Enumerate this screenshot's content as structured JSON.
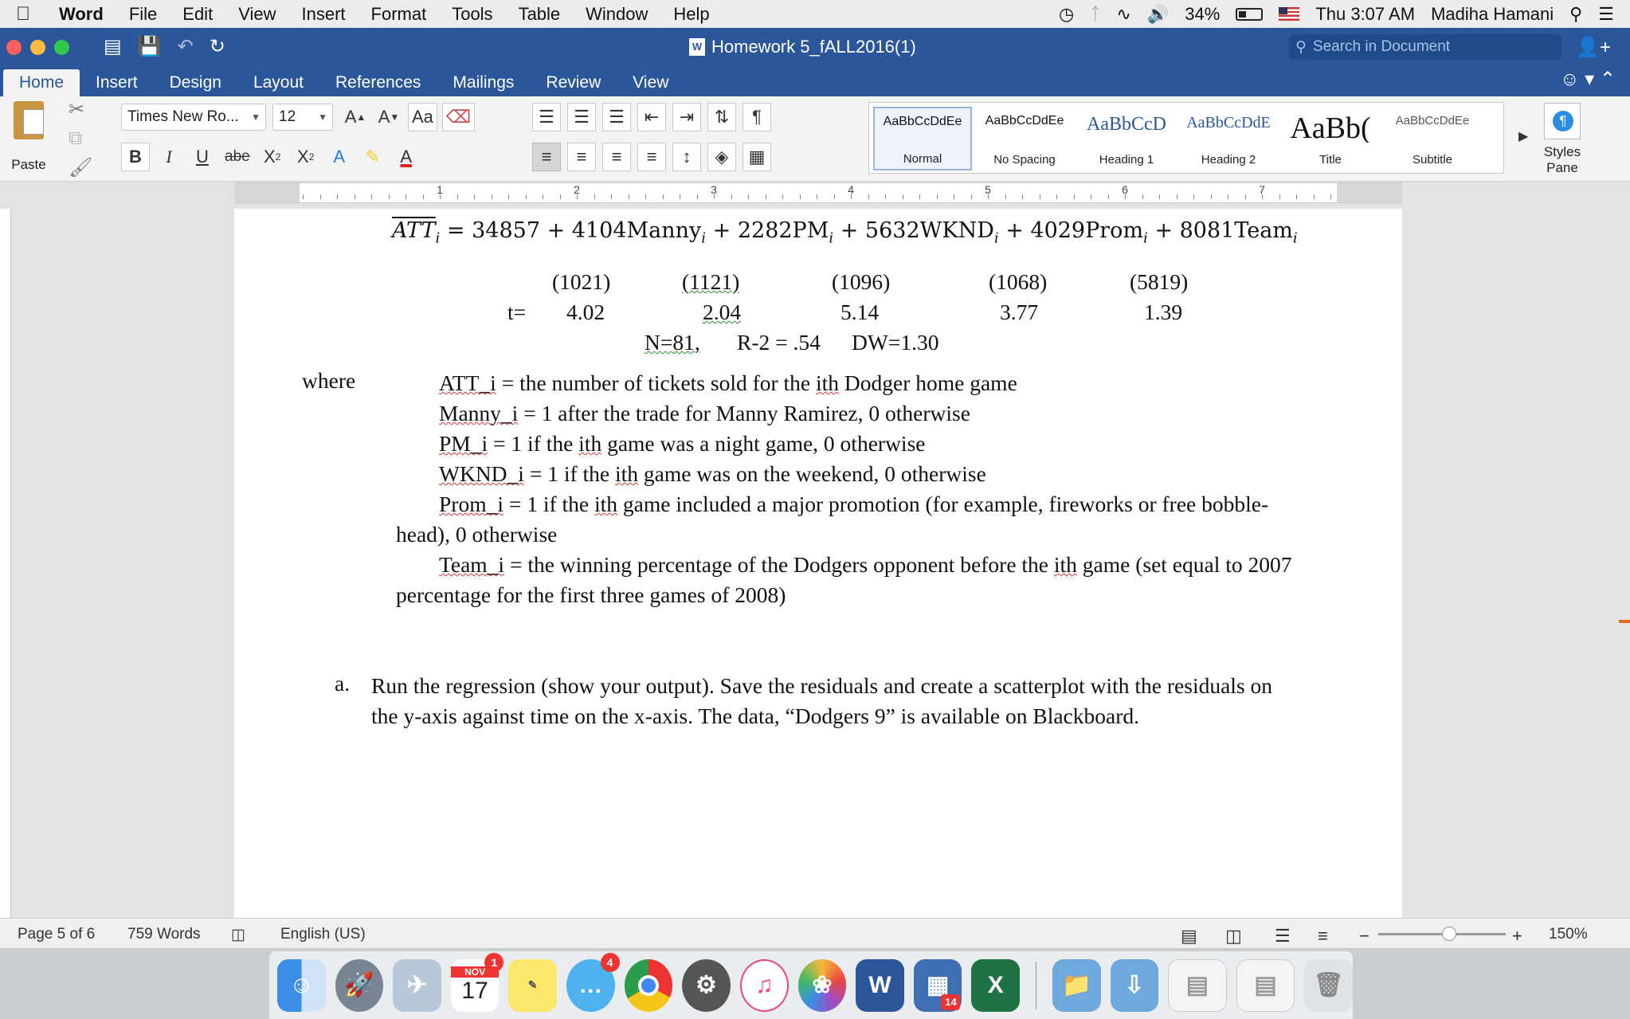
{
  "menubar": {
    "app": "Word",
    "items": [
      "File",
      "Edit",
      "View",
      "Insert",
      "Format",
      "Tools",
      "Table",
      "Window",
      "Help"
    ],
    "battery": "34%",
    "clock": "Thu 3:07 AM",
    "user": "Madiha Hamani"
  },
  "titlebar": {
    "document_title": "Homework 5_fALL2016(1)",
    "search_placeholder": "Search in Document"
  },
  "ribbon": {
    "tabs": [
      "Home",
      "Insert",
      "Design",
      "Layout",
      "References",
      "Mailings",
      "Review",
      "View"
    ],
    "active_tab": "Home",
    "paste_label": "Paste",
    "font_name": "Times New Ro...",
    "font_size": "12",
    "grow_font": "A",
    "shrink_font": "A",
    "change_case": "Aa",
    "bold": "B",
    "italic": "I",
    "underline": "U",
    "strikethrough": "abe",
    "subscript": "X",
    "superscript": "X",
    "text_effects": "A",
    "font_color": "A",
    "styles": [
      {
        "sample": "AaBbCcDdEe",
        "name": "Normal"
      },
      {
        "sample": "AaBbCcDdEe",
        "name": "No Spacing"
      },
      {
        "sample": "AaBbCcD",
        "name": "Heading 1"
      },
      {
        "sample": "AaBbCcDdE",
        "name": "Heading 2"
      },
      {
        "sample": "AaBb(",
        "name": "Title"
      },
      {
        "sample": "AaBbCcDdEe",
        "name": "Subtitle"
      }
    ],
    "styles_pane": "Styles Pane"
  },
  "ruler": {
    "numbers": [
      "1",
      "2",
      "3",
      "4",
      "5",
      "6",
      "7"
    ]
  },
  "document": {
    "equation": {
      "lhs": "ATT",
      "rhs": "= 34857 + 4104Manny",
      "t2": " + 2282PM",
      "t3": " + 5632WKND",
      "t4": " + 4029Prom",
      "t5": " + 8081Team",
      "sub": "i"
    },
    "std_errors": [
      "(1021)",
      "(1121)",
      "(1096)",
      "(1068)",
      "(5819)"
    ],
    "t_label": "t=",
    "t_values": [
      "4.02",
      "2.04",
      "5.14",
      "3.77",
      "1.39"
    ],
    "stats": {
      "n": "N=81,",
      "r2": "R-2 = .54",
      "dw": "DW=1.30"
    },
    "where": "where",
    "definitions": [
      {
        "var": "ATT_i",
        "text": " = the number of tickets sold for the ",
        "ith": "ith",
        "rest": " Dodger home game"
      },
      {
        "var": "Manny_i",
        "text": " = 1 after the trade for Manny Ramirez, 0 otherwise"
      },
      {
        "var": "PM_i",
        "text": " = 1 if the ",
        "ith": "ith",
        "rest": " game was a night game, 0 otherwise"
      },
      {
        "var": "WKND_i",
        "text": " = 1 if the ",
        "ith": "ith",
        "rest": " game was on the weekend, 0 otherwise"
      },
      {
        "var": "Prom_i",
        "text": " = 1 if the ",
        "ith": "ith",
        "rest": " game included a major promotion (for example, fireworks or free bobble-"
      },
      {
        "var": "Team_i",
        "text": " = the winning percentage of the Dodgers opponent before the ",
        "ith": "ith",
        "rest": " game (set equal to 2007"
      }
    ],
    "prom_continuation": "head), 0 otherwise",
    "team_continuation": "percentage for the first three games of 2008)",
    "question_marker": "a.",
    "question_line1": "Run the regression (show your output). Save the residuals and create a scatterplot with the residuals on",
    "question_line2": "the y-axis against time on the x-axis. The data, “Dodgers 9” is available on Blackboard."
  },
  "statusbar": {
    "page": "Page 5 of 6",
    "words": "759 Words",
    "language": "English (US)",
    "zoom": "150%",
    "zoom_level_percent": 150
  },
  "dock": {
    "calendar_month": "NOV",
    "calendar_day": "17",
    "calendar_badge": "1",
    "messages_badge": "4",
    "excel_badge": "14"
  }
}
